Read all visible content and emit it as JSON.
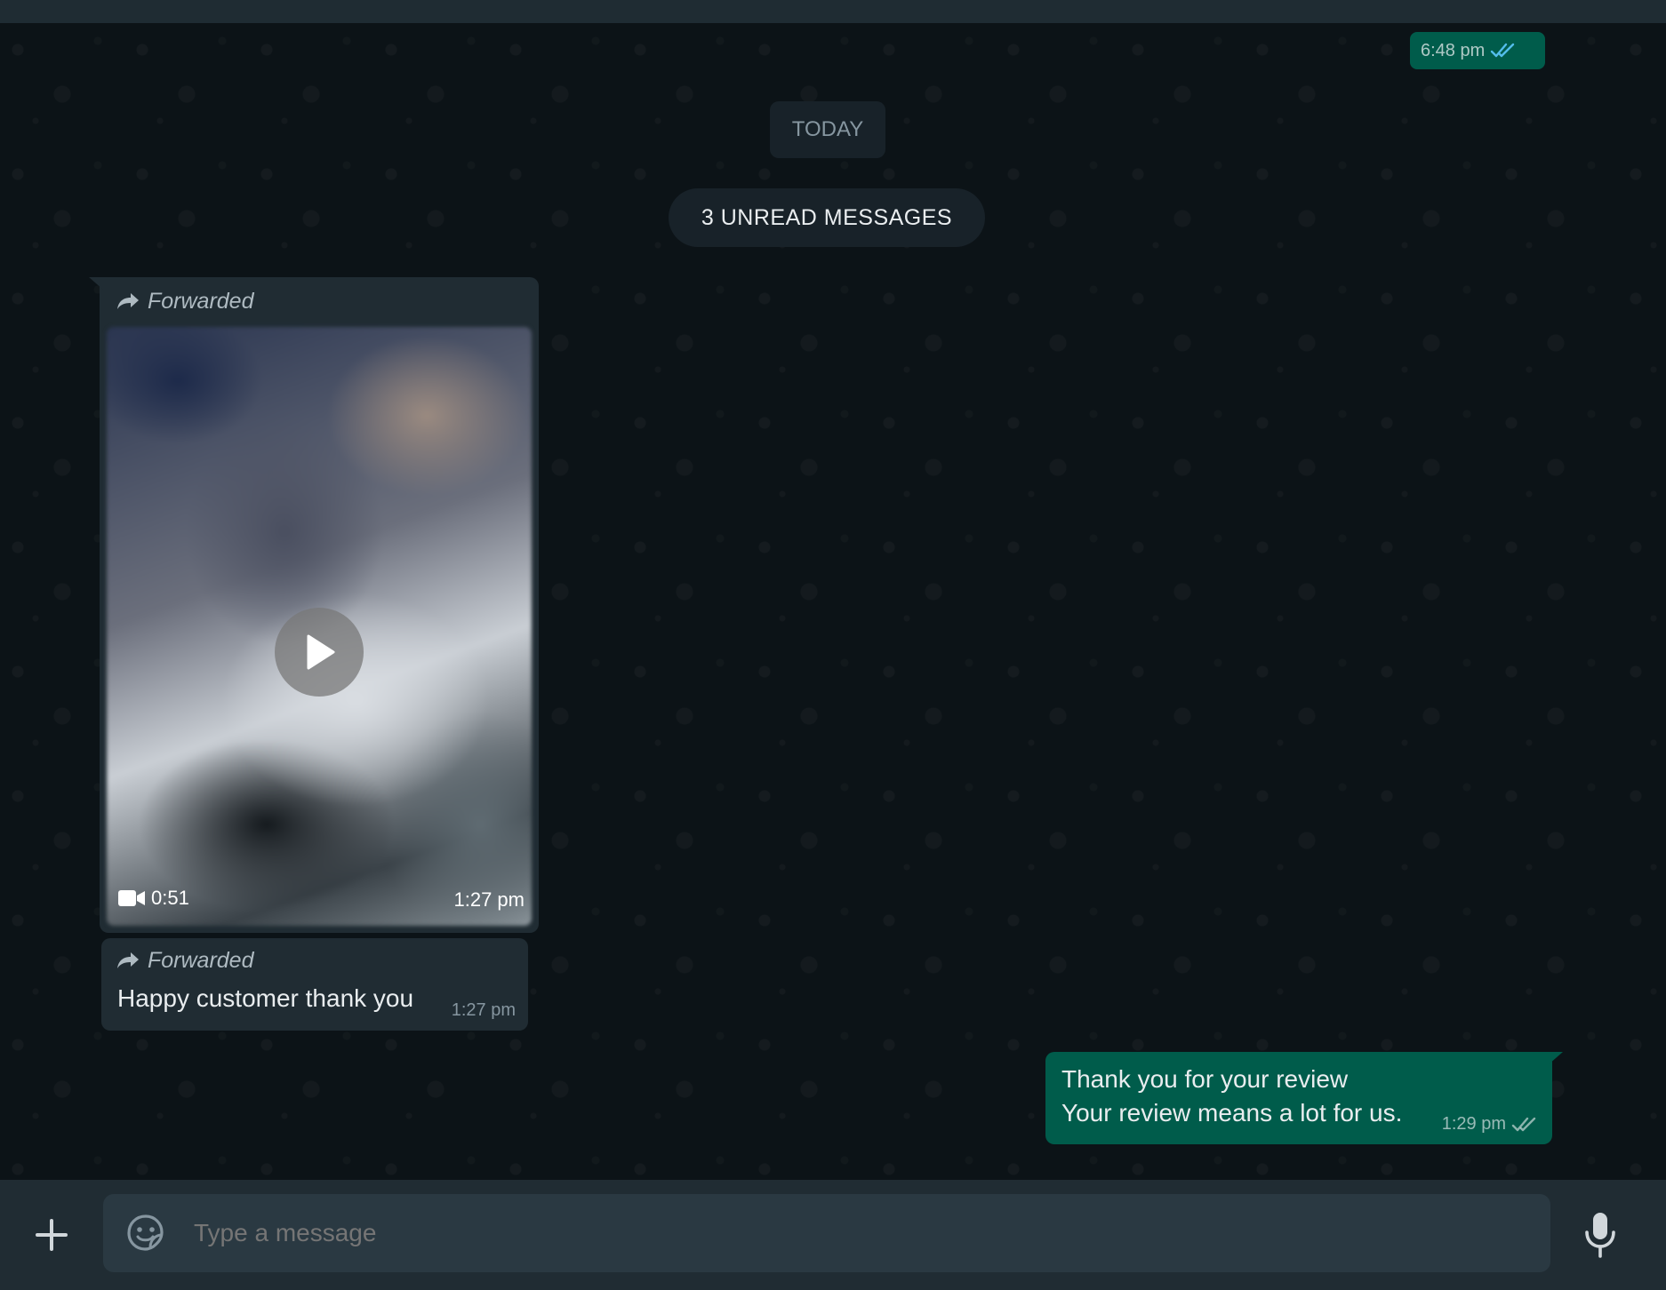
{
  "top_message": {
    "time": "6:48 pm",
    "status_icon": "double-check-read-icon"
  },
  "date_divider": "TODAY",
  "unread_divider": "3 UNREAD MESSAGES",
  "messages": [
    {
      "type": "video",
      "forwarded_label": "Forwarded",
      "duration": "0:51",
      "time": "1:27 pm"
    },
    {
      "type": "text",
      "forwarded_label": "Forwarded",
      "text": "Happy customer thank you",
      "time": "1:27 pm"
    },
    {
      "type": "text-outgoing",
      "line1": "Thank you for your review",
      "line2": "Your review means a lot for us.",
      "time": "1:29 pm",
      "status_icon": "double-check-icon"
    }
  ],
  "composer": {
    "placeholder": "Type a message",
    "attach_icon": "plus-icon",
    "sticker_icon": "sticker-icon",
    "mic_icon": "microphone-icon"
  },
  "colors": {
    "outgoing_bubble": "#005c4b",
    "incoming_bubble": "#202c33",
    "read_check": "#53bdeb",
    "background": "#0b141a"
  }
}
